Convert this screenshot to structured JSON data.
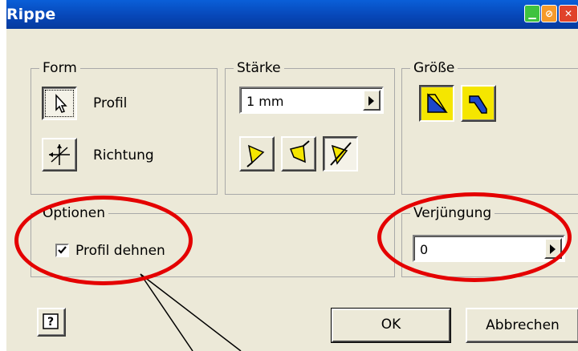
{
  "window": {
    "title": "Rippe"
  },
  "form_group": {
    "label": "Form",
    "profile_button_label": "Profil",
    "direction_button_label": "Richtung"
  },
  "thickness_group": {
    "label": "Stärke",
    "value": "1 mm"
  },
  "size_group": {
    "label": "Größe"
  },
  "options_group": {
    "label": "Optionen",
    "extend_profile_label": "Profil dehnen",
    "extend_profile_checked": true
  },
  "taper_group": {
    "label": "Verjüngung",
    "value": "0"
  },
  "footer": {
    "help_label": "?",
    "ok_label": "OK",
    "cancel_label": "Abbrechen"
  },
  "colors": {
    "title_bar": "#0a5fd8",
    "dialog_bg": "#ece9d8",
    "highlight_ellipse": "#e40000",
    "icon_yellow": "#f5e600",
    "icon_blue": "#1d47c9"
  }
}
